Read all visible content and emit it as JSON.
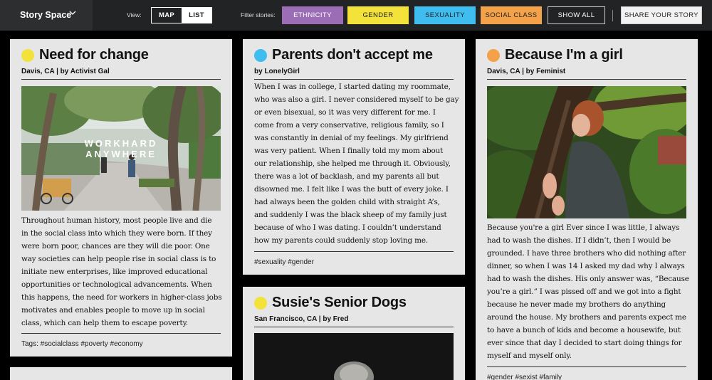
{
  "topbar": {
    "brand": "Story Space",
    "view_label": "View:",
    "view_map": "MAP",
    "view_list": "LIST",
    "filter_label": "Filter stories:",
    "filters": [
      {
        "label": "ETHNICITY",
        "color": "#9b6db4",
        "text_color": "#ffffff"
      },
      {
        "label": "GENDER",
        "color": "#f3e23a",
        "text_color": "#222222"
      },
      {
        "label": "SEXUALITY",
        "color": "#3fbdee",
        "text_color": "#222222"
      },
      {
        "label": "SOCIAL CLASS",
        "color": "#f4a24a",
        "text_color": "#222222"
      }
    ],
    "show_all": "SHOW ALL",
    "share": "SHARE YOUR STORY"
  },
  "cards": [
    {
      "title": "Need for change",
      "dot_color": "#f3e23a",
      "byline": "Davis, CA | by Activist Gal",
      "image_text_1": "WORKHARD",
      "image_text_2": "ANYWHERE",
      "lines": [
        "Throughout human history, most people live and die",
        "in the social class into which they were born. If they",
        "were born poor, chances are they will die poor. One",
        "way societies can help people rise in social class is to",
        "initiate new enterprises, like improved educational",
        "opportunities or technological advancements. When",
        "this happens, the need for workers in higher-class jobs",
        "motivates and enables people to move up in social",
        "class, which can help them to escape poverty."
      ],
      "tags": "Tags: #socialclass #poverty #economy"
    },
    {
      "title": "Parents don't accept me",
      "dot_color": "#3fbdee",
      "byline": "by LonelyGirl",
      "lines": [
        "When I was in college, I started dating my roommate,",
        "who was also a girl. I never considered myself to be gay",
        "or even bisexual, so it was very different for me. I",
        "come from a very conservative, religious family, so I",
        "was constantly in denial of my feelings. My girlfriend",
        "was very patient. When I finally told my mom about",
        "our relationship, she helped me through it. Obviously,",
        "there was a lot of backlash, and my parents all but",
        "disowned me. I felt like I was the butt of every joke. I",
        "had always been the golden child with straight A’s,",
        "and suddenly I was the black sheep of my family just",
        "because of who I was dating. I couldn’t understand",
        "how my parents could suddenly stop loving me."
      ],
      "tags": "#sexuality #gender"
    },
    {
      "title": "Susie's Senior Dogs",
      "dot_color": "#f3e23a",
      "byline": "San Francisco, CA | by Fred"
    },
    {
      "title": "Because I'm a girl",
      "dot_color": "#f4a24a",
      "byline": "Davis, CA | by Feminist",
      "lines": [
        "Because you're a girl Ever since I was little, I always",
        "had to wash the dishes. If I didn’t, then I would be",
        "grounded. I have three brothers who did nothing after",
        "dinner, so when I was 14 I asked my dad why I always",
        "had to wash the dishes. His only answer was, “Because",
        "you’re a girl.” I was pissed off and we got into a fight",
        "because he never made my brothers do anything",
        "around the house. My brothers and parents expect me",
        "to have a bunch of kids and become a housewife, but",
        "ever since that day I decided to start doing things for",
        "myself and myself only."
      ],
      "tags": "#gender #sexist #family"
    }
  ]
}
